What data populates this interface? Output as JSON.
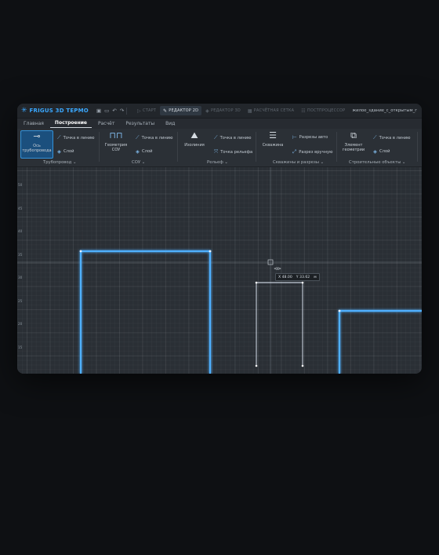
{
  "app": {
    "logo_mark": "✳",
    "logo_text": "FRIGUS 3D  ТЕРМО",
    "quick_actions": [
      "save-icon",
      "folder-icon",
      "undo-icon",
      "redo-icon"
    ],
    "filename": "жилое_здание_с_открытым_г"
  },
  "modes": [
    {
      "label": "СТАРТ",
      "icon": "▷",
      "active": false
    },
    {
      "label": "РЕДАКТОР 2D",
      "icon": "✎",
      "active": true
    },
    {
      "label": "РЕДАКТОР 3D",
      "icon": "◈",
      "active": false
    },
    {
      "label": "РАСЧЁТНАЯ СЕТКА",
      "icon": "▦",
      "active": false
    },
    {
      "label": "ПОСТПРОЦЕССОР",
      "icon": "☷",
      "active": false
    }
  ],
  "menu_tabs": [
    "Главная",
    "Построение",
    "Расчёт",
    "Результаты",
    "Вид"
  ],
  "active_menu_tab": "Построение",
  "ribbon": {
    "pipes": {
      "big": "Ось трубопровода",
      "small1": "Точка в линию",
      "small2": "Слой",
      "label": "Трубопровод ⌄"
    },
    "cou": {
      "big": "Геометрия СОУ",
      "small1": "Точка в линию",
      "small2": "Слой",
      "label": "СОУ ⌄"
    },
    "relief": {
      "big": "Изолиния",
      "small1": "Точка в линию",
      "small2": "Точка рельефа",
      "label": "Рельеф ⌄"
    },
    "wells": {
      "big": "Скважина",
      "small1": "Разрезы авто",
      "small2": "Разрез вручную",
      "label": "Скважины и разрезы ⌄"
    },
    "building": {
      "big": "Элемент геометрии",
      "small1": "Точка в линию",
      "small2": "Слой",
      "label": "Строительные объекты ⌄"
    }
  },
  "ruler_ticks": [
    "50",
    "45",
    "40",
    "35",
    "30",
    "25",
    "20",
    "15"
  ],
  "cursor": {
    "x_label": "X 48.00",
    "y_label": "Y 33.62",
    "unit": "м"
  },
  "colors": {
    "accent": "#3aa8ff",
    "shape_glow": "#4fb0ff",
    "selected_outline": "#e8f2ff"
  }
}
